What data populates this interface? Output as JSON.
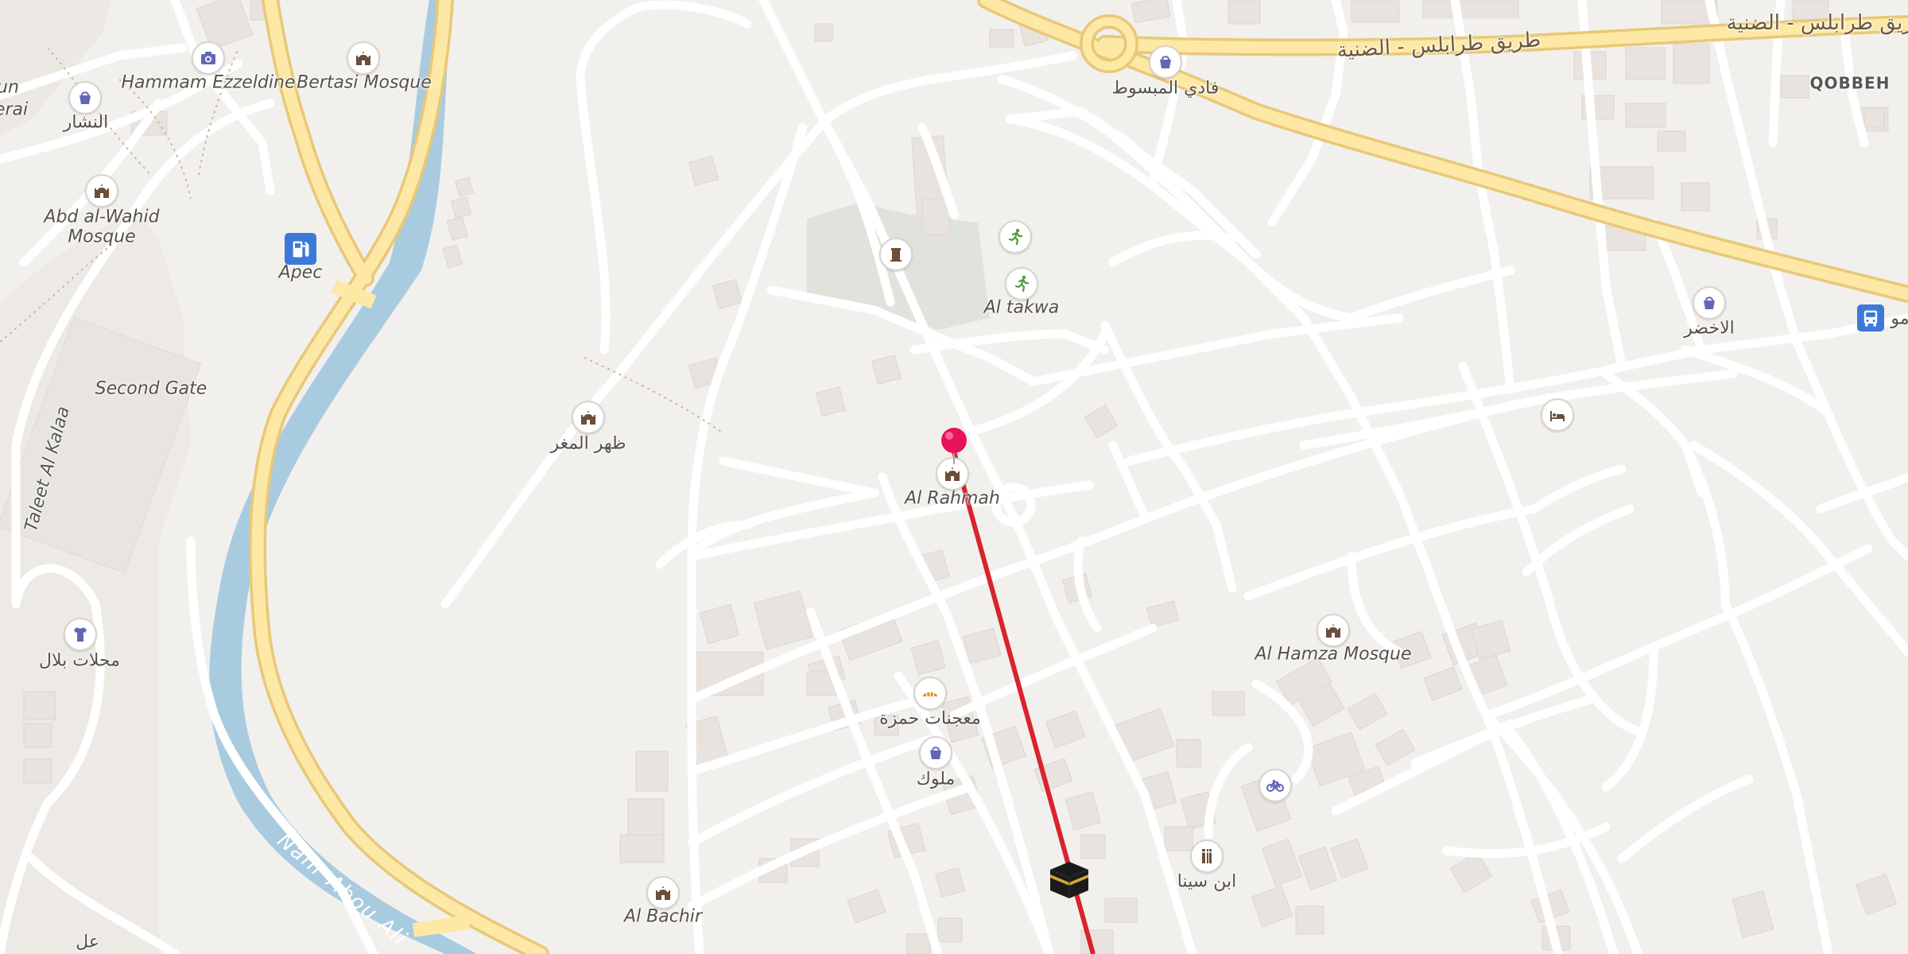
{
  "map": {
    "districts": {
      "qobbeh": "QOBBEH"
    },
    "roads": {
      "tripoli_dinniyeh_1": "طريق طرابلس - الضنية",
      "tripoli_dinniyeh_2": "طريق طرابلس - الضنية",
      "taleet_al_kalaa": "Taleet Al Kalaa"
    },
    "river": {
      "name": "Nahr Abou Ali"
    },
    "places": {
      "hammam": "Hammam Ezzeldine",
      "bertasi": "Bertasi Mosque",
      "nashar": "النشار",
      "abd_wahid": "Abd al-Wahid Mosque",
      "apec": "Apec",
      "second_gate": "Second Gate",
      "zahr_mughr": "ظهر المغر",
      "mahallat_bilal": "محلات بلال",
      "fadi_mabsout": "فادي المبسوط",
      "al_takwa": "Al takwa",
      "al_rahmah": "Al Rahmah",
      "al_akhdar": "الاخضر",
      "al_hamza": "Al Hamza Mosque",
      "hamza_pastry": "معجنات حمزة",
      "mlouk": "ملوك",
      "ibn_sina": "ابن سينا",
      "al_bachir": "Al Bachir",
      "edge_left_top": "un",
      "edge_left_2": "erai",
      "edge_right": "مو",
      "edge_bottom": "عل"
    },
    "icons": {
      "camera": "camera-icon",
      "mosque": "mosque-icon",
      "shop": "shopping-bag-icon",
      "fuel": "fuel-station-icon",
      "clothes": "clothing-shop-icon",
      "fitness": "fitness-icon",
      "monument": "monument-icon",
      "bakery": "bakery-icon",
      "bicycle": "bicycle-icon",
      "pharmacy": "pharmacy-icon",
      "hotel": "hotel-icon",
      "bus": "bus-stop-icon",
      "pin": "location-pin-icon",
      "kaaba": "kaaba-icon"
    },
    "colors": {
      "background": "#f2f0ed",
      "road_minor": "#ffffff",
      "road_major": "#fbe49c",
      "river": "#a9cbe0",
      "park": "#dfe3dc",
      "building": "#e8e3de",
      "qibla_line": "#d9232e",
      "pin": "#e8125a",
      "poi_icon": "#6466b5"
    }
  }
}
